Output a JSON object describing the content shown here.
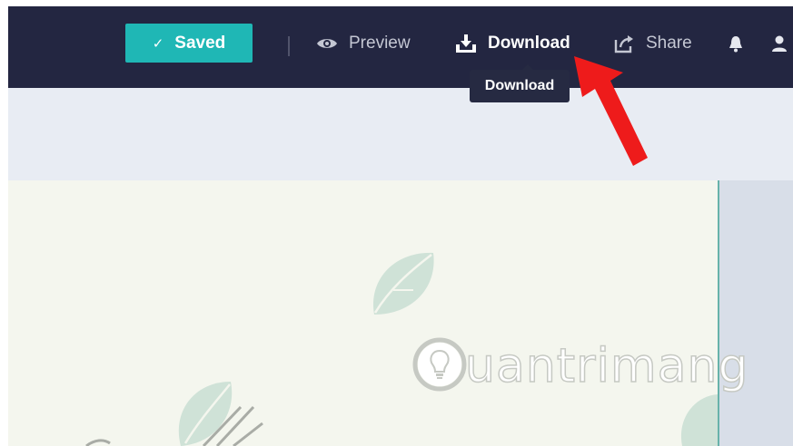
{
  "topbar": {
    "saved_label": "Saved",
    "preview_label": "Preview",
    "download_label": "Download",
    "share_label": "Share"
  },
  "tooltip": {
    "text": "Download"
  },
  "watermark": {
    "text": "uantrimang"
  },
  "colors": {
    "topbar_bg": "#232641",
    "saved_button": "#1fb7b5",
    "canvas_bg": "#f4f6ee",
    "leaf": "#cfe2d7",
    "arrow": "#ee1b1b"
  }
}
